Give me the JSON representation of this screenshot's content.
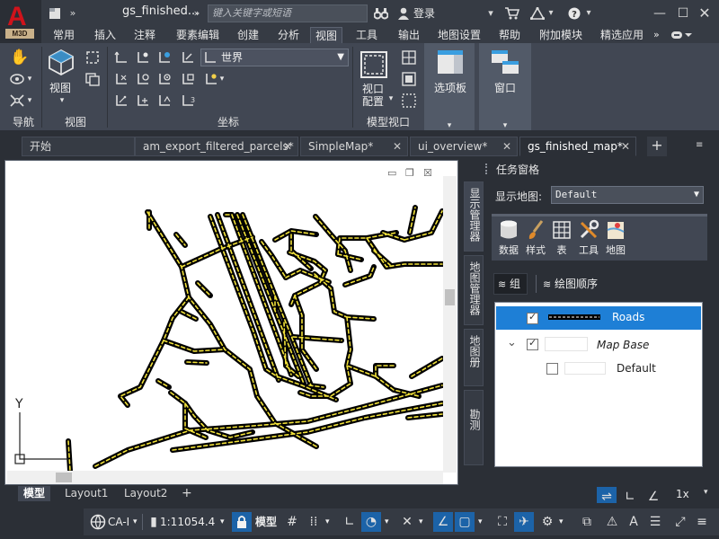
{
  "app": {
    "logo_letter": "A",
    "logo_badge": "M3D",
    "document_title": "gs_finished...",
    "search_placeholder": "键入关键字或短语",
    "login_label": "登录",
    "icons": [
      "new-file-icon",
      "more-icon",
      "binoculars-icon",
      "user-icon",
      "cart-icon",
      "autodesk-app-icon",
      "help-icon",
      "minimize-icon",
      "restore-icon",
      "close-icon"
    ]
  },
  "menu": {
    "tabs": [
      "常用",
      "插入",
      "注释",
      "要素编辑",
      "创建",
      "分析",
      "视图",
      "工具",
      "输出",
      "地图设置",
      "帮助",
      "附加模块",
      "精选应用"
    ],
    "active": "视图"
  },
  "ribbon": {
    "panels": {
      "navigate": "导航",
      "view": "视图",
      "coordinates": "坐标",
      "model_viewports": "模型视口"
    },
    "view_button": "视图",
    "ucs_value": "世界",
    "viewport_config_line1": "视口",
    "viewport_config_line2": "配置",
    "palettes_button": "选项板",
    "window_button": "窗口"
  },
  "doc_tabs": [
    {
      "label": "开始",
      "closable": false,
      "active": false
    },
    {
      "label": "am_export_filtered_parcels*",
      "closable": true,
      "active": false
    },
    {
      "label": "SimpleMap*",
      "closable": true,
      "active": false
    },
    {
      "label": "ui_overview*",
      "closable": true,
      "active": false
    },
    {
      "label": "gs_finished_map*",
      "closable": true,
      "active": true
    }
  ],
  "drawing": {
    "ucs_y_label": "Y",
    "ucs_x_label": "X"
  },
  "task_pane": {
    "title": "任务窗格",
    "vertical_tabs": [
      "显示管理器",
      "地图管理器",
      "地图册",
      "勘测"
    ],
    "display_map_label": "显示地图:",
    "display_map_value": "Default",
    "tools": [
      {
        "label": "数据",
        "icon": "database-icon"
      },
      {
        "label": "样式",
        "icon": "brush-icon"
      },
      {
        "label": "表",
        "icon": "table-icon"
      },
      {
        "label": "工具",
        "icon": "tools-icon"
      },
      {
        "label": "地图",
        "icon": "map-icon"
      }
    ],
    "group_label": "组",
    "draw_order_label": "绘图顺序",
    "layers": [
      {
        "name": "Roads",
        "checked": true,
        "selected": true,
        "italic": false
      },
      {
        "name": "Map Base",
        "checked": true,
        "selected": false,
        "italic": true
      },
      {
        "name": "Default",
        "checked": false,
        "selected": false,
        "italic": false
      }
    ]
  },
  "layout_tabs": [
    "模型",
    "Layout1",
    "Layout2"
  ],
  "status": {
    "coord_system": "CA-I",
    "scale": "1:11054.4",
    "model_label": "模型",
    "zoom_label": "1x"
  },
  "colors": {
    "accent": "#1c63a8",
    "selected_row": "#1e7fd6",
    "road_dash": "#f2e23a",
    "road_casing": "#000000"
  }
}
